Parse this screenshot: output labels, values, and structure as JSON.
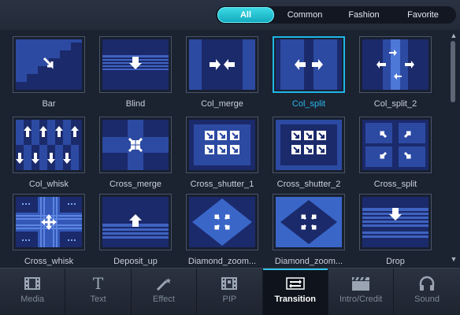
{
  "filters": {
    "tabs": [
      "All",
      "Common",
      "Fashion",
      "Favorite"
    ],
    "active": "All"
  },
  "transitions": [
    {
      "label": "Bar",
      "icon": "bar-transition-icon"
    },
    {
      "label": "Blind",
      "icon": "blind-transition-icon"
    },
    {
      "label": "Col_merge",
      "icon": "col-merge-transition-icon"
    },
    {
      "label": "Col_split",
      "icon": "col-split-transition-icon",
      "selected": true
    },
    {
      "label": "Col_split_2",
      "icon": "col-split-2-transition-icon"
    },
    {
      "label": "Col_whisk",
      "icon": "col-whisk-transition-icon"
    },
    {
      "label": "Cross_merge",
      "icon": "cross-merge-transition-icon"
    },
    {
      "label": "Cross_shutter_1",
      "icon": "cross-shutter-1-transition-icon"
    },
    {
      "label": "Cross_shutter_2",
      "icon": "cross-shutter-2-transition-icon"
    },
    {
      "label": "Cross_split",
      "icon": "cross-split-transition-icon"
    },
    {
      "label": "Cross_whisk",
      "icon": "cross-whisk-transition-icon"
    },
    {
      "label": "Deposit_up",
      "icon": "deposit-up-transition-icon"
    },
    {
      "label": "Diamond_zoom...",
      "icon": "diamond-zoom-in-transition-icon"
    },
    {
      "label": "Diamond_zoom...",
      "icon": "diamond-zoom-out-transition-icon"
    },
    {
      "label": "Drop",
      "icon": "drop-transition-icon"
    }
  ],
  "nav": {
    "items": [
      {
        "label": "Media",
        "icon": "film-icon"
      },
      {
        "label": "Text",
        "icon": "text-icon"
      },
      {
        "label": "Effect",
        "icon": "magic-wand-icon"
      },
      {
        "label": "PIP",
        "icon": "pip-film-icon"
      },
      {
        "label": "Transition",
        "icon": "transition-icon"
      },
      {
        "label": "Intro/Credit",
        "icon": "clapperboard-icon"
      },
      {
        "label": "Sound",
        "icon": "headphones-icon"
      }
    ],
    "active": "Transition"
  },
  "colors": {
    "accent": "#2ec3e8",
    "selected_label": "#29b8f0",
    "thumb_dark": "#1b2a6b",
    "thumb_light": "#2e4ea8"
  }
}
